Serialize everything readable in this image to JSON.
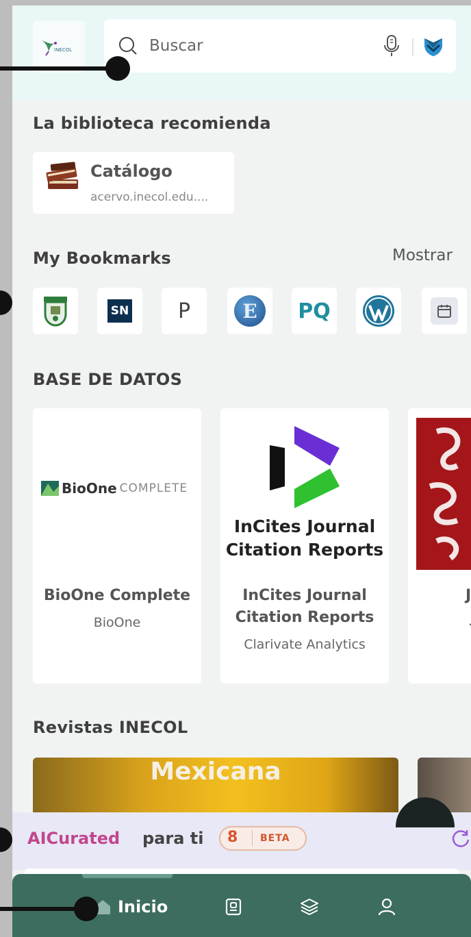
{
  "search": {
    "placeholder": "Buscar"
  },
  "logo": {
    "text": "INECOL"
  },
  "recommend": {
    "title": "La biblioteca recomienda",
    "catalog_name": "Catálogo",
    "catalog_url": "acervo.inecol.edu...."
  },
  "bookmarks": {
    "title": "My Bookmarks",
    "show_label": "Mostrar",
    "items": [
      {
        "icon": "crest-icon"
      },
      {
        "icon": "springer-nature-icon",
        "text": "SN"
      },
      {
        "icon": "p-letter-icon",
        "text": "P"
      },
      {
        "icon": "e-globe-icon",
        "text": "E"
      },
      {
        "icon": "proquest-icon",
        "text": "PQ"
      },
      {
        "icon": "wordpress-icon"
      },
      {
        "icon": "calendar-icon"
      }
    ]
  },
  "databases": {
    "title": "BASE DE DATOS",
    "items": [
      {
        "logo_bold": "BioOne",
        "logo_light": "COMPLETE",
        "name": "BioOne Complete",
        "vendor": "BioOne"
      },
      {
        "logo_line1": "InCites Journal",
        "logo_line2": "Citation Reports",
        "name_line1": "InCites Journal",
        "name_line2": "Citation Reports",
        "vendor": "Clarivate Analytics"
      },
      {
        "name": "J",
        "vendor": "."
      }
    ]
  },
  "journals": {
    "title": "Revistas INECOL",
    "cover_text": "Mexicana"
  },
  "ai": {
    "brand": "AICurated",
    "tail": "para ti",
    "badge_glyph": "8",
    "badge": "BETA"
  },
  "nav": {
    "home_label": "Inicio"
  },
  "colors": {
    "nav_bg": "#3d6d5f",
    "ai_brand": "#c2468e",
    "beta_badge": "#d6562c",
    "search_bg": "#ffffff",
    "header_bg": "#eaf7f7"
  }
}
